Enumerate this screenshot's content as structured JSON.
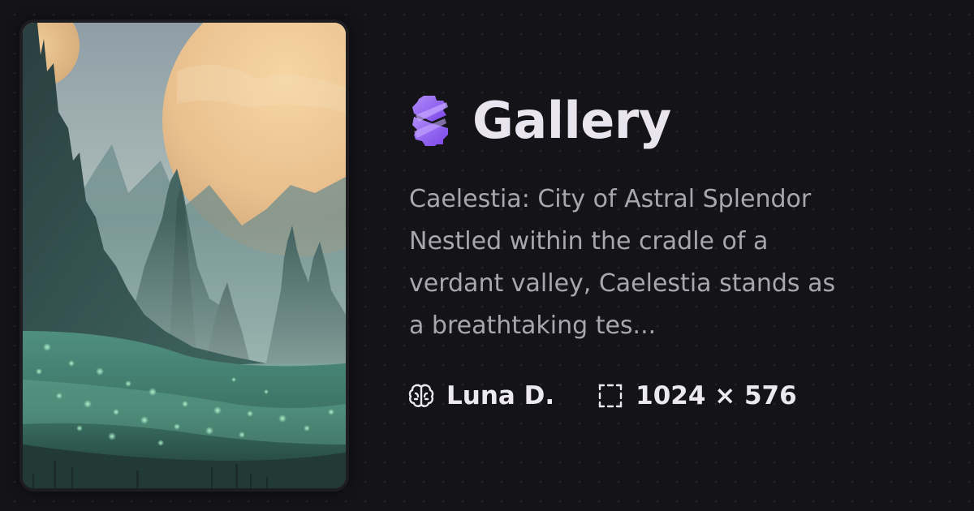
{
  "brand": {
    "title": "Gallery",
    "logo_icon": "gear-lightning-logo-icon",
    "accent": "#9b6cf0"
  },
  "artwork": {
    "description_lines": [
      "Caelestia: City of Astral Splendor",
      "Nestled within the cradle of a",
      "verdant valley, Caelestia stands as",
      "a breathtaking tes..."
    ],
    "author": "Luna D.",
    "author_icon": "brain-icon",
    "dimensions": "1024 × 576",
    "dimensions_icon": "dashed-frame-icon"
  },
  "colors": {
    "background": "#141318",
    "title": "#e9e5ee",
    "description": "#a9a6ae",
    "meta": "#ebe8ef"
  }
}
